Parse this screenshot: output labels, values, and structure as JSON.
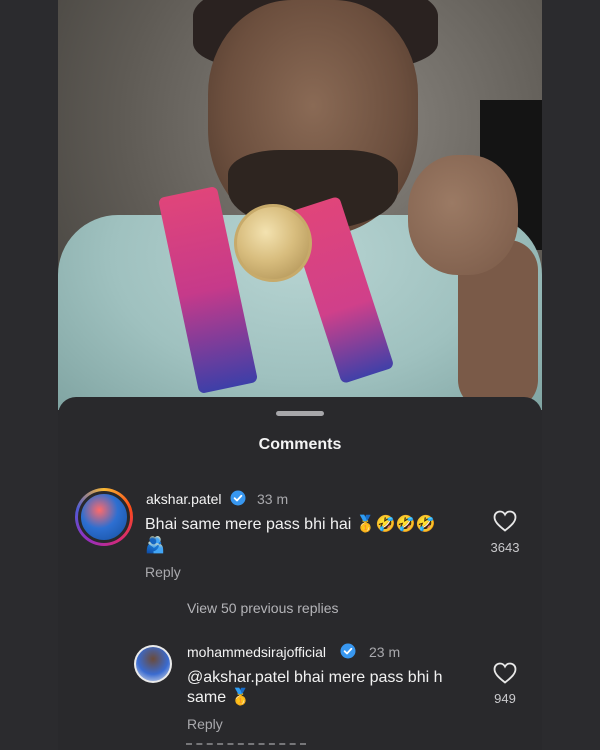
{
  "sheet": {
    "title": "Comments"
  },
  "comments": [
    {
      "username": "akshar.patel",
      "time": "33 m",
      "text": "Bhai same mere pass bhi hai 🥇🤣🤣🤣",
      "text_line2": "🫂",
      "likes": "3643",
      "reply_label": "Reply"
    },
    {
      "username": "mohammedsirajofficial",
      "time": "23 m",
      "text": "@akshar.patel bhai mere pass bhi h",
      "text_line2": "same 🥇",
      "likes": "949",
      "reply_label": "Reply"
    }
  ],
  "view_previous": "View 50 previous replies",
  "icons": {
    "verified": "verified-badge-icon",
    "heart": "heart-outline-icon"
  },
  "colors": {
    "verified_blue": "#3897f0",
    "sheet_bg": "#29292c"
  }
}
